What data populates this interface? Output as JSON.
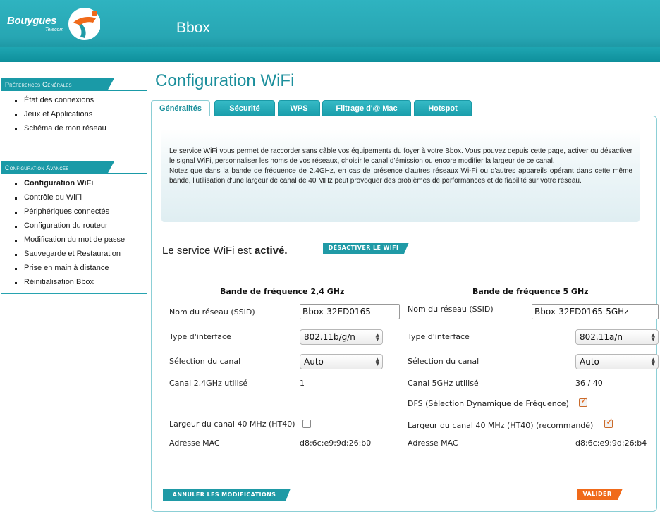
{
  "header": {
    "logo_text": "Bouygues",
    "logo_sub": "Telecom",
    "app_title": "Bbox"
  },
  "sidebar": {
    "general": {
      "title": "Préférences Générales",
      "items": [
        "État des connexions",
        "Jeux et Applications",
        "Schéma de mon réseau"
      ]
    },
    "advanced": {
      "title": "Configuration Avancée",
      "items": [
        "Configuration WiFi",
        "Contrôle du WiFi",
        "Périphériques connectés",
        "Configuration du routeur",
        "Modification du mot de passe",
        "Sauvegarde et Restauration",
        "Prise en main à distance",
        "Réinitialisation Bbox"
      ],
      "active": "Configuration WiFi"
    }
  },
  "main": {
    "title": "Configuration WiFi",
    "tabs": [
      {
        "label": "Généralités",
        "active": true
      },
      {
        "label": "Sécurité",
        "active": false
      },
      {
        "label": "WPS",
        "active": false
      },
      {
        "label": "Filtrage d'@ Mac",
        "active": false
      },
      {
        "label": "Hotspot",
        "active": false
      }
    ],
    "info_p1": "Le service WiFi vous permet de raccorder sans câble vos équipements du foyer à votre Bbox. Vous pouvez depuis cette page, activer ou désactiver le signal WiFi, personnaliser les noms de vos réseaux, choisir le canal d'émission ou encore modifier la largeur de ce canal.",
    "info_p2": "Notez que dans la bande de fréquence de 2,4GHz, en cas de présence d'autres réseaux Wi-Fi ou d'autres appareils opérant dans cette même bande, l'utilisation d'une largeur de canal de 40 MHz peut provoquer des problèmes de performances et de fiabilité sur votre réseau.",
    "status_prefix": "Le service WiFi est",
    "status_value": "activé.",
    "deactivate_label": "DÉSACTIVER LE WIFI",
    "band24": {
      "title": "Bande de fréquence 2,4 GHz",
      "ssid_label": "Nom du réseau (SSID)",
      "ssid_value": "Bbox-32ED0165",
      "iface_label": "Type d'interface",
      "iface_value": "802.11b/g/n",
      "channel_label": "Sélection du canal",
      "channel_value": "Auto",
      "used_label": "Canal 2,4GHz utilisé",
      "used_value": "1",
      "ht40_label": "Largeur du canal 40 MHz (HT40)",
      "ht40_checked": false,
      "mac_label": "Adresse MAC",
      "mac_value": "d8:6c:e9:9d:26:b0"
    },
    "band5": {
      "title": "Bande de fréquence 5 GHz",
      "ssid_label": "Nom du réseau (SSID)",
      "ssid_value": "Bbox-32ED0165-5GHz",
      "iface_label": "Type d'interface",
      "iface_value": "802.11a/n",
      "channel_label": "Sélection du canal",
      "channel_value": "Auto",
      "used_label": "Canal 5GHz utilisé",
      "used_value": "36 / 40",
      "dfs_label": "DFS (Sélection Dynamique de Fréquence)",
      "dfs_checked": true,
      "ht40_label": "Largeur du canal 40 MHz (HT40) (recommandé)",
      "ht40_checked": true,
      "mac_label": "Adresse MAC",
      "mac_value": "d8:6c:e9:9d:26:b4"
    },
    "cancel_label": "ANNULER LES MODIFICATIONS",
    "validate_label": "VALIDER"
  },
  "colors": {
    "brand_teal": "#1f9aa6",
    "title_teal": "#1c8f9c",
    "accent_orange": "#f06a1a"
  }
}
